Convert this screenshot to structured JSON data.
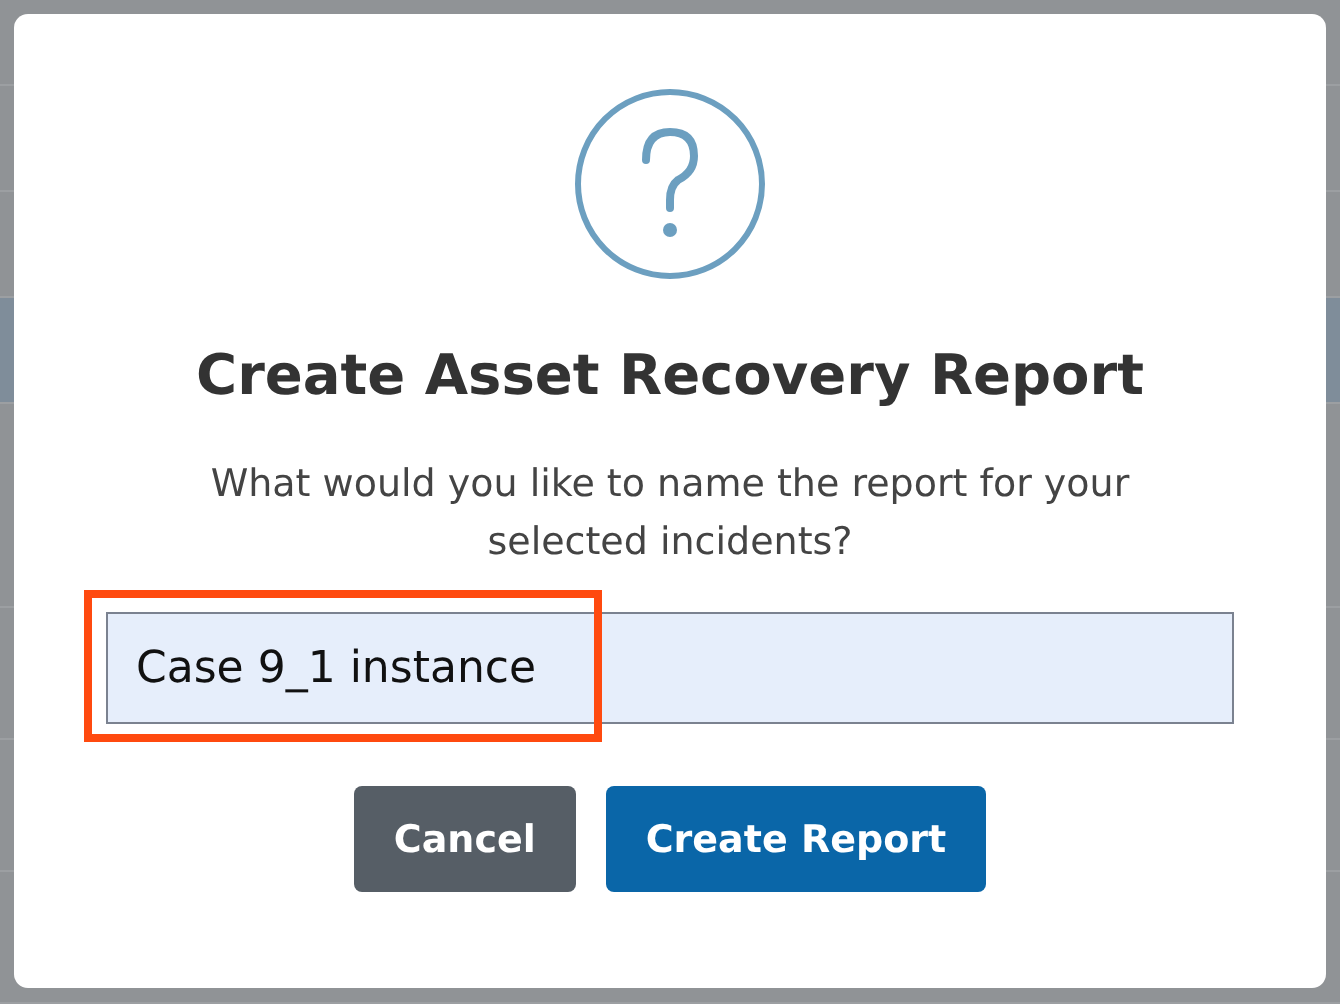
{
  "background_table": {
    "rows": [
      {
        "selected": false
      },
      {
        "selected": false
      },
      {
        "selected": true
      },
      {
        "selected": false
      }
    ]
  },
  "dialog": {
    "title": "Create Asset Recovery Report",
    "message": "What would you like to name the report for your selected incidents?",
    "field": {
      "value": "Case 9_1 instance",
      "highlighted": true
    },
    "buttons": [
      {
        "label": "Cancel",
        "kind": "secondary"
      },
      {
        "label": "Create Report",
        "kind": "primary"
      }
    ]
  }
}
